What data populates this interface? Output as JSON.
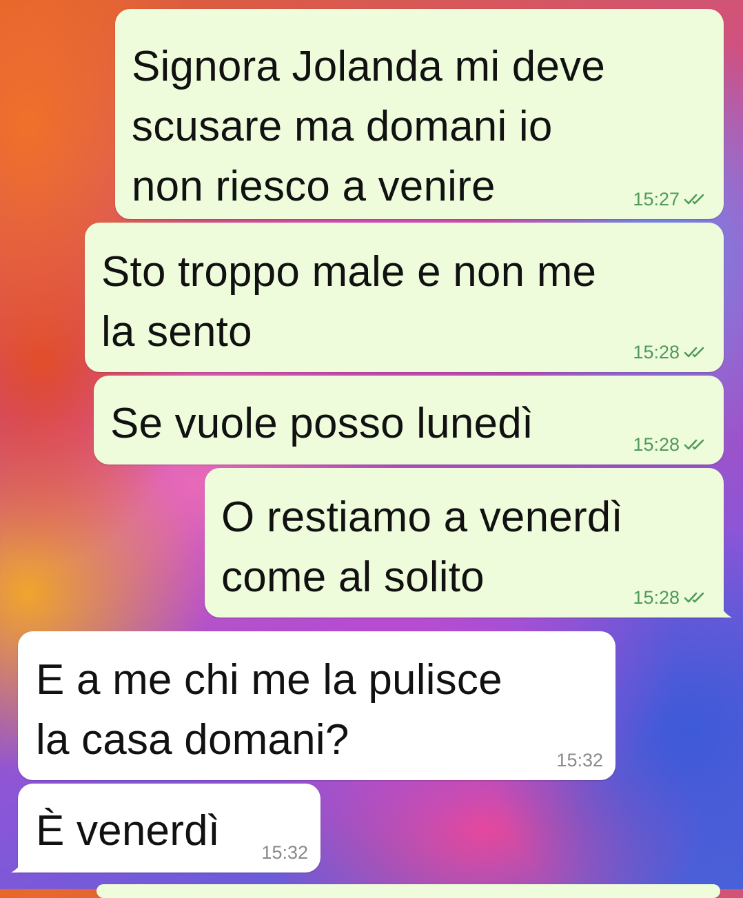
{
  "messages": [
    {
      "direction": "outgoing",
      "text": "Signora Jolanda mi deve\nscusare ma domani io\nnon riesco a venire",
      "time": "15:27",
      "status_icon": "double-check-icon"
    },
    {
      "direction": "outgoing",
      "text": "Sto troppo male e non me\nla sento",
      "time": "15:28",
      "status_icon": "double-check-icon"
    },
    {
      "direction": "outgoing",
      "text": "Se vuole posso lunedì",
      "time": "15:28",
      "status_icon": "double-check-icon"
    },
    {
      "direction": "outgoing",
      "text": "O restiamo a venerdì\ncome al solito",
      "time": "15:28",
      "status_icon": "double-check-icon"
    },
    {
      "direction": "incoming",
      "text": "E a me chi me la pulisce\nla casa domani?",
      "time": "15:32"
    },
    {
      "direction": "incoming",
      "text": "È venerdì",
      "time": "15:32"
    }
  ],
  "colors": {
    "outgoing_bubble": "#eefcdc",
    "incoming_bubble": "#ffffff",
    "read_ticks": "#4f9a5a",
    "incoming_time": "#8a8a8a"
  }
}
